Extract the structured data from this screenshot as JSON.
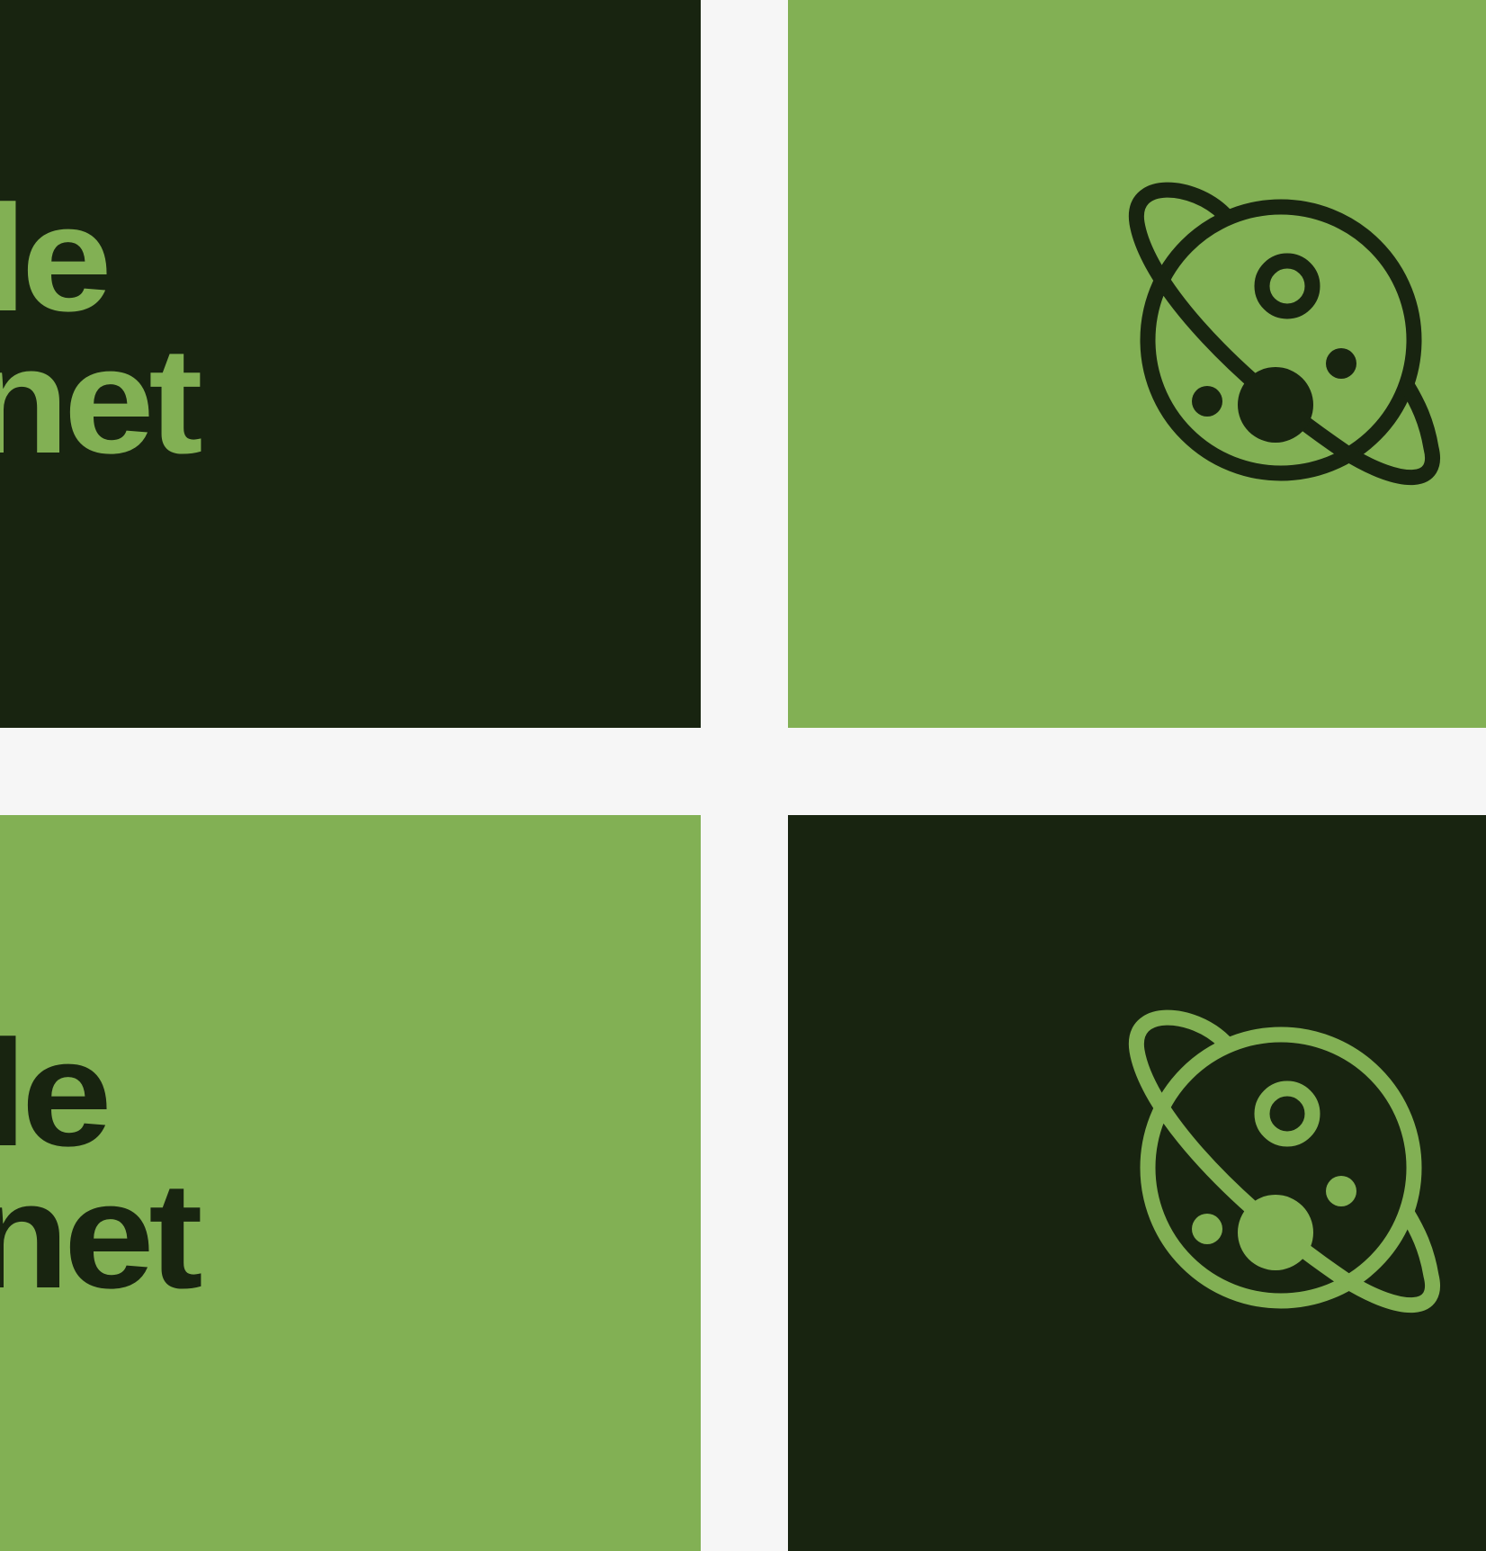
{
  "brand": {
    "line1": "ttle",
    "line2": "anet",
    "icon": "planet-icon"
  },
  "colors": {
    "dark": "#182410",
    "light": "#82b054",
    "gap": "#f6f6f6"
  }
}
